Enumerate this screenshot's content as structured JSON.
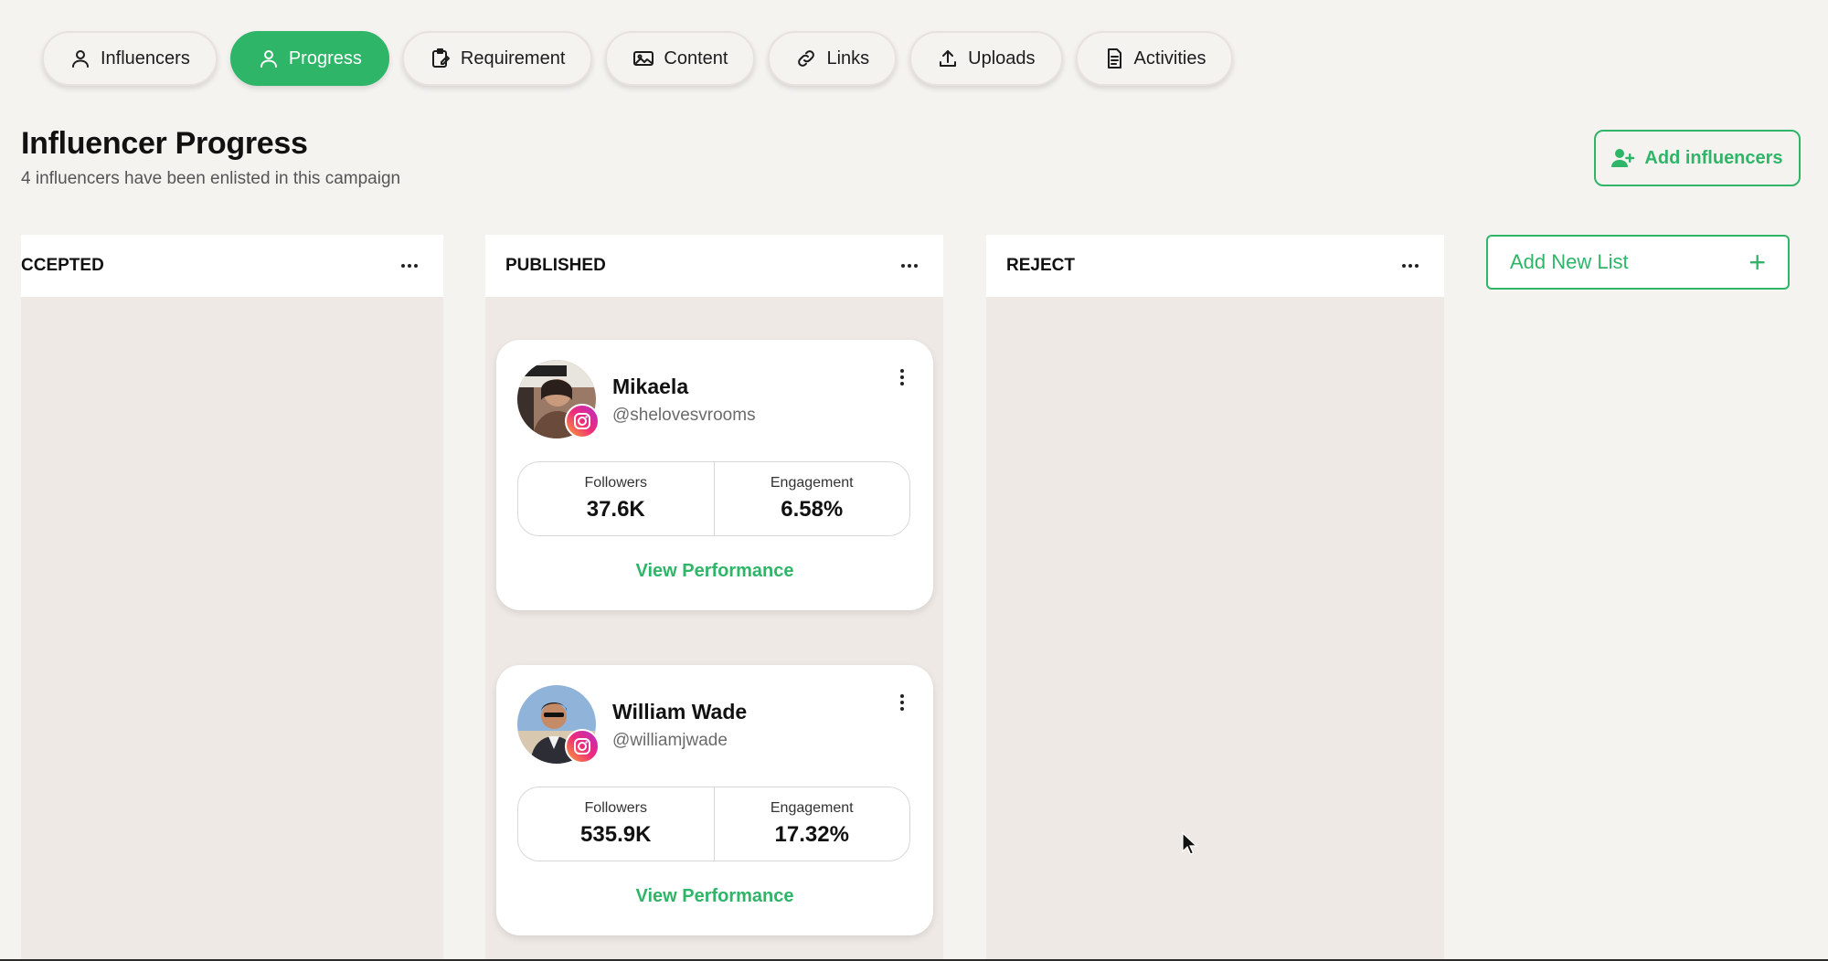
{
  "tabs": [
    {
      "label": "Influencers",
      "icon": "users-icon",
      "active": false
    },
    {
      "label": "Progress",
      "icon": "users-icon",
      "active": true
    },
    {
      "label": "Requirement",
      "icon": "clipboard-edit-icon",
      "active": false
    },
    {
      "label": "Content",
      "icon": "images-icon",
      "active": false
    },
    {
      "label": "Links",
      "icon": "link-icon",
      "active": false
    },
    {
      "label": "Uploads",
      "icon": "upload-icon",
      "active": false
    },
    {
      "label": "Activities",
      "icon": "document-icon",
      "active": false
    }
  ],
  "header": {
    "title": "Influencer Progress",
    "subtitle": "4 influencers have been enlisted in this campaign",
    "add_influencers_label": "Add influencers"
  },
  "columns": [
    {
      "title": "CCEPTED"
    },
    {
      "title": "PUBLISHED"
    },
    {
      "title": "REJECT"
    }
  ],
  "add_list_label": "Add New List",
  "cards": [
    {
      "name": "Mikaela",
      "handle": "@shelovesvrooms",
      "platform_icon": "instagram-icon",
      "followers_label": "Followers",
      "followers": "37.6K",
      "engagement_label": "Engagement",
      "engagement": "6.58%",
      "action_label": "View Performance"
    },
    {
      "name": "William Wade",
      "handle": "@williamjwade",
      "platform_icon": "instagram-icon",
      "followers_label": "Followers",
      "followers": "535.9K",
      "engagement_label": "Engagement",
      "engagement": "17.32%",
      "action_label": "View Performance"
    }
  ],
  "colors": {
    "accent": "#2fb568",
    "background": "#f5f3f0",
    "column_bg": "#efe9e5"
  }
}
